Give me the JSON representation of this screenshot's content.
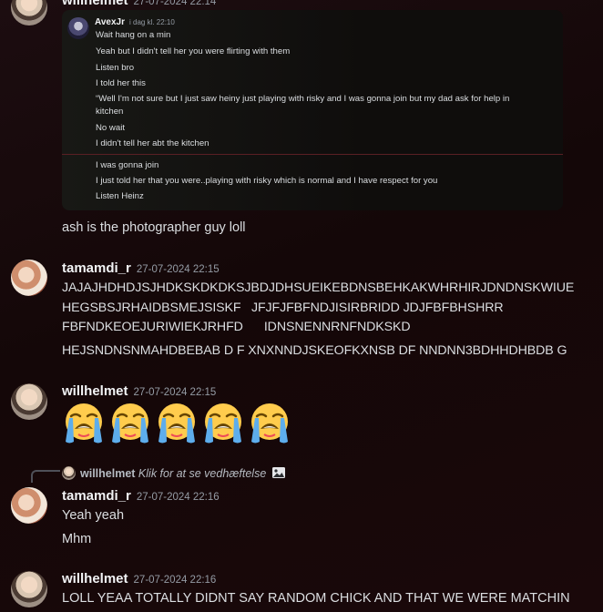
{
  "top_msg": {
    "author": "willhelmet",
    "timestamp": "27-07-2024 22:14",
    "embed": {
      "author": "AvexJr",
      "timestamp": "i dag kl. 22:10",
      "lines": [
        "Wait hang on a min",
        "Yeah but I didn't tell her you were flirting with them",
        "Listen bro",
        "I told her this",
        "“Well I'm not sure but I just saw heiny just playing with risky and I was gonna join but my dad ask for help in",
        "kitchen",
        "No wait",
        "I didn't tell her abt the kitchen"
      ],
      "lines_after": [
        "I was gonna join",
        "I just told her that you were..playing with risky which is normal and I have respect for you",
        "Listen Heinz"
      ]
    },
    "text": "ash is the photographer guy loll"
  },
  "msg2": {
    "author": "tamamdi_r",
    "timestamp": "27-07-2024 22:15",
    "lines": [
      "JAJAJHDHDJSJHDKSKDKDKSJBDJDHSUEIKEBDNSBEHKAKWHRHIRJDNDNSKWIUE",
      "HEGSBSJRHAIDBSMEJSISKF   JFJFJFBFNDJISIRBRIDD JDJFBFBHSHRR",
      "FBFNDKEOEJURIWIEKJRHFD      IDNSNENNRNFNDKSKD",
      "HEJSNDNSNMAHDBEBAB D F XNXNNDJSKEOFKXNSB DF NNDNN3BDHHDHBDB G"
    ]
  },
  "msg3": {
    "author": "willhelmet",
    "timestamp": "27-07-2024 22:15",
    "emoji_count": 5,
    "emoji_name": "loudly-crying-face"
  },
  "msg4": {
    "reply": {
      "author": "willhelmet",
      "text": "Klik for at se vedhæftelse"
    },
    "author": "tamamdi_r",
    "timestamp": "27-07-2024 22:16",
    "lines": [
      "Yeah yeah",
      "Mhm"
    ]
  },
  "msg5": {
    "author": "willhelmet",
    "timestamp": "27-07-2024 22:16",
    "text": "LOLL YEAA TOTALLY DIDNT SAY RANDOM CHICK AND THAT WE WERE MATCHIN"
  },
  "colors": {
    "background": "#150809",
    "embed_background": "#0f0d0c",
    "embed_separator": "#5a1f24",
    "username": "#f2f3f5",
    "timestamp": "#949ba4",
    "text": "#dbdee1"
  }
}
